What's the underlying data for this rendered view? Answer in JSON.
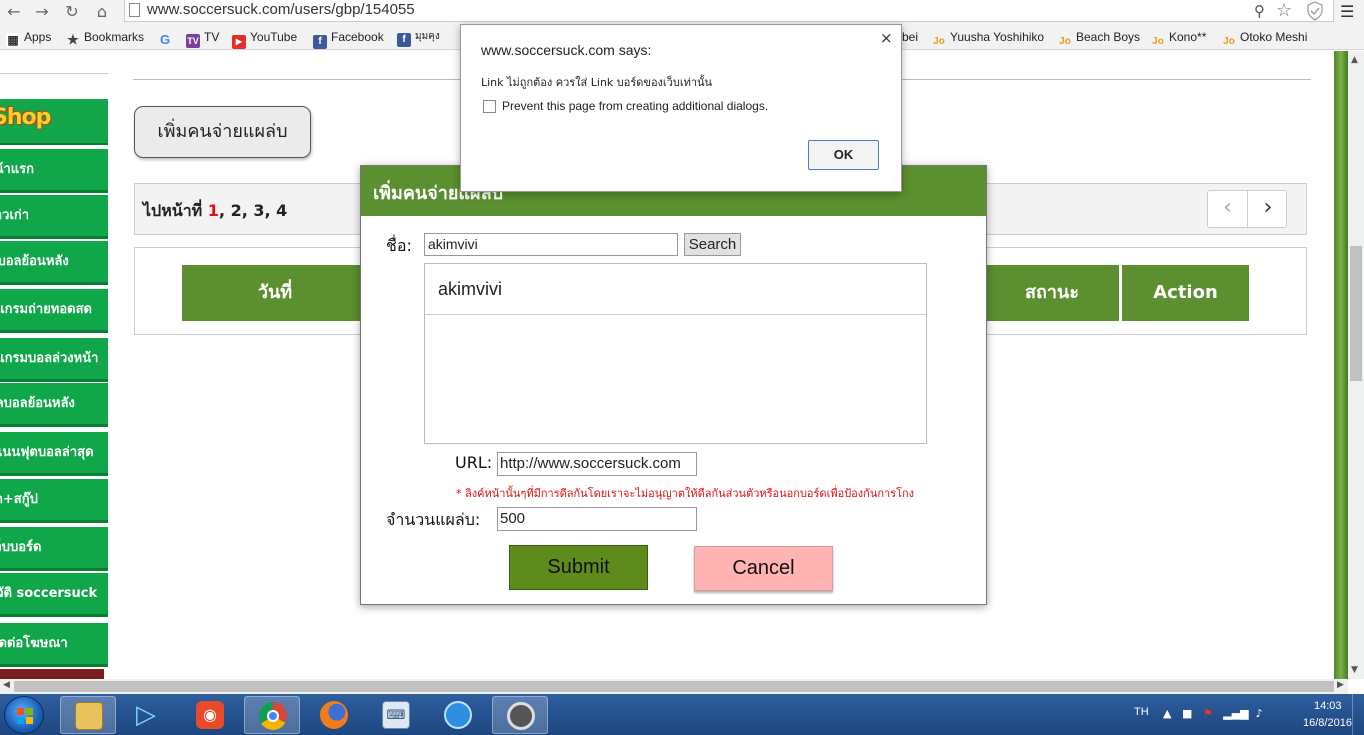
{
  "browser": {
    "url": "www.soccersuck.com/users/gbp/154055",
    "bookmarks": [
      {
        "label": "Apps",
        "icon": "apps-grid-icon"
      },
      {
        "label": "Bookmarks",
        "icon": "star-icon"
      },
      {
        "label": "",
        "icon": "google-icon"
      },
      {
        "label": "TV",
        "icon": "tv-icon"
      },
      {
        "label": "YouTube",
        "icon": "youtube-icon"
      },
      {
        "label": "Facebook",
        "icon": "facebook-icon"
      },
      {
        "label": "มุมคุง",
        "icon": "facebook-icon"
      },
      {
        "label": "bei",
        "icon": ""
      },
      {
        "label": "Yuusha Yoshihiko",
        "icon": "jo-icon"
      },
      {
        "label": "Beach Boys",
        "icon": "jo-icon"
      },
      {
        "label": "Kono**",
        "icon": "jo-icon"
      },
      {
        "label": "Otoko Meshi",
        "icon": "jo-icon"
      }
    ]
  },
  "sidebar": {
    "shop_label": "Shop",
    "items": [
      {
        "label": "หน้าแรก"
      },
      {
        "label": "ข่าวเก่า"
      },
      {
        "label": "ข่าวบอลย้อนหลัง"
      },
      {
        "label": "โปรแกรมถ่ายทอดสด"
      },
      {
        "label": "โปรแกรมบอลล่วงหน้า"
      },
      {
        "label": "ผลบอลย้อนหลัง"
      },
      {
        "label": "ตารางคะแนนฟุตบอลล่าสุด"
      },
      {
        "label": "ทีเด็ดพรีเมียร์ลีก+สกู๊ป"
      },
      {
        "label": "เว็บบอร์ด"
      },
      {
        "label": "ประวัติ soccersuck"
      },
      {
        "label": "ติดต่อโฆษณา"
      }
    ]
  },
  "main": {
    "add_button": "เพิ่มคนจ่ายแผล่บ",
    "pager": {
      "prefix": "ไปหน้าที่ ",
      "current": "1",
      "rest": ", 2, 3, 4"
    },
    "table_headers": {
      "date": "วันที่",
      "status": "สถานะ",
      "action": "Action"
    }
  },
  "modal": {
    "title": "เพิ่มคนจ่ายแผล่บ",
    "name_label": "ชื่อ:",
    "name_value": "akimvivi",
    "search_label": "Search",
    "results": [
      "akimvivi"
    ],
    "url_label": "URL:",
    "url_value": "http://www.soccersuck.com",
    "warning": "* ลิงค์หน้านั้นๆที่มีการดีลกันโดยเราจะไม่อนุญาตให้ดีลกันส่วนตัวหรือนอกบอร์ดเพื่อป้องกันการโกง",
    "amount_label": "จำนวนแผล่บ:",
    "amount_value": "500",
    "submit_label": "Submit",
    "cancel_label": "Cancel"
  },
  "alert": {
    "title": "www.soccersuck.com says:",
    "message": "Link ไม่ถูกต้อง ควรใส่ Link บอร์ดของเว็บเท่านั้น",
    "checkbox_label": "Prevent this page from creating additional dialogs.",
    "ok_label": "OK"
  },
  "taskbar": {
    "apps": [
      "file-explorer-icon",
      "media-player-icon",
      "recorder-icon",
      "chrome-icon",
      "firefox-icon",
      "network-computer-icon",
      "qq-icon",
      "app-icon"
    ],
    "language": "TH",
    "time": "14:03",
    "date": "16/8/2016"
  },
  "colors": {
    "header_green": "#5b8f2f",
    "sidebar_green": "#10a64a",
    "submit_green": "#5f8a1c",
    "cancel_pink": "#ffb3b3",
    "alert_red": "#dd1111"
  }
}
